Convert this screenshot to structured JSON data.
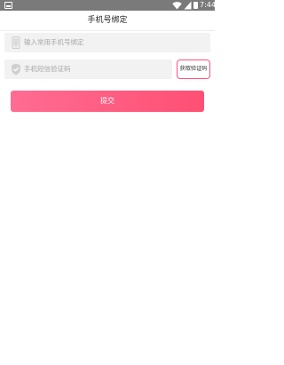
{
  "status_bar": {
    "time": "7:44",
    "icons": [
      "notification-icon",
      "wifi-icon",
      "signal-icon",
      "battery-icon"
    ]
  },
  "header": {
    "title": "手机号绑定"
  },
  "form": {
    "phone_placeholder": "输入常用手机号绑定",
    "code_placeholder": "手机短信验证码",
    "get_code_label": "获取验证码",
    "submit_label": "提交"
  },
  "colors": {
    "accent": "#ff4f7a",
    "button_gradient_start": "#ff6c92",
    "button_gradient_end": "#ff4f74",
    "status_bar": "#7a7a7a",
    "field_background": "#f2f2f2"
  }
}
